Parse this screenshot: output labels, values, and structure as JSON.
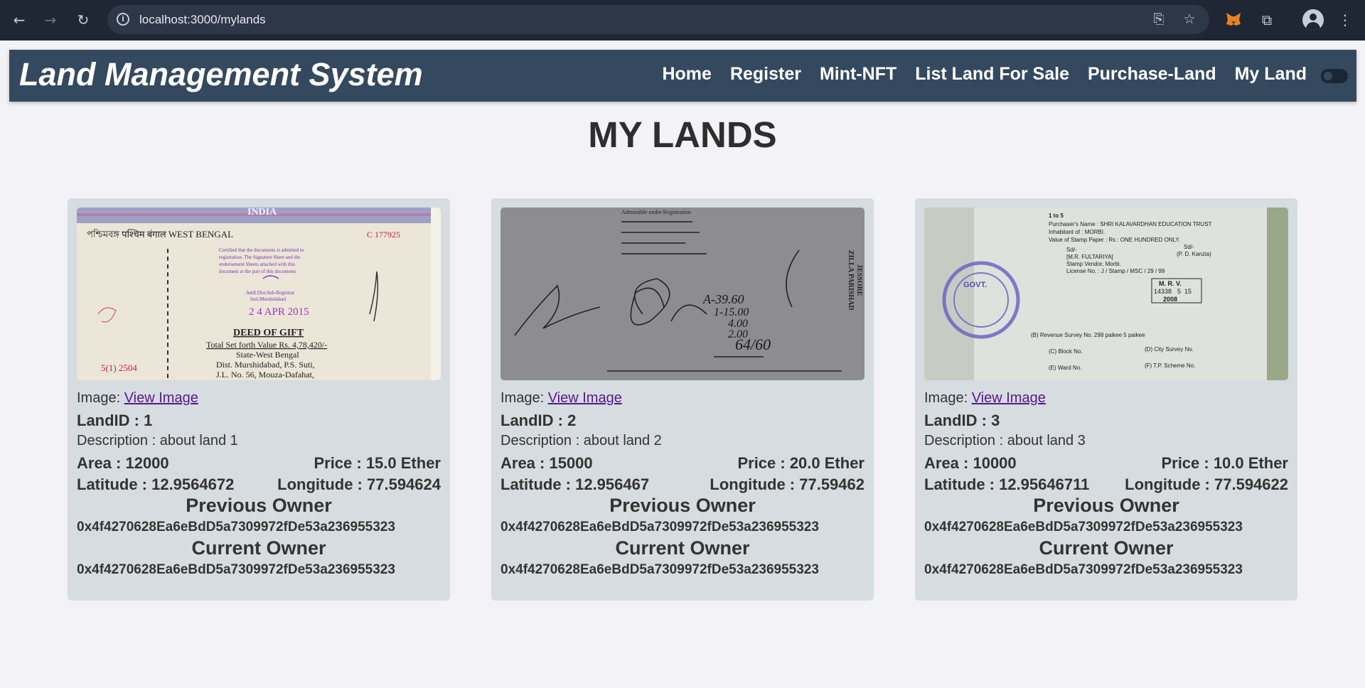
{
  "browser": {
    "url": "localhost:3000/mylands"
  },
  "app": {
    "brand": "Land Management System",
    "nav": [
      "Home",
      "Register",
      "Mint-NFT",
      "List Land For Sale",
      "Purchase-Land",
      "My Land"
    ]
  },
  "page": {
    "title": "MY LANDS"
  },
  "labels": {
    "image_prefix": "Image: ",
    "view_image": "View Image",
    "previous_owner": "Previous Owner",
    "current_owner": "Current Owner"
  },
  "cards": [
    {
      "landid": "LandID : 1",
      "description": "Description : about land 1",
      "area": "Area : 12000",
      "price": "Price : 15.0 Ether",
      "latitude": "Latitude : 12.9564672",
      "longitude": "Longitude : 77.594624",
      "previous_owner": "0x4f4270628Ea6eBdD5a7309972fDe53a236955323",
      "current_owner": "0x4f4270628Ea6eBdD5a7309972fDe53a236955323"
    },
    {
      "landid": "LandID : 2",
      "description": "Description : about land 2",
      "area": "Area : 15000",
      "price": "Price : 20.0 Ether",
      "latitude": "Latitude : 12.956467",
      "longitude": "Longitude : 77.59462",
      "previous_owner": "0x4f4270628Ea6eBdD5a7309972fDe53a236955323",
      "current_owner": "0x4f4270628Ea6eBdD5a7309972fDe53a236955323"
    },
    {
      "landid": "LandID : 3",
      "description": "Description : about land 3",
      "area": "Area : 10000",
      "price": "Price : 10.0 Ether",
      "latitude": "Latitude : 12.95646711",
      "longitude": "Longitude : 77.594622",
      "previous_owner": "0x4f4270628Ea6eBdD5a7309972fDe53a236955323",
      "current_owner": "0x4f4270628Ea6eBdD5a7309972fDe53a236955323"
    }
  ],
  "deed_images": {
    "1": {
      "title": "INDIA",
      "state_line": "পশ্চিমবঙ্গ पश्चिम बंगाल WEST BENGAL",
      "serial": "C 177925",
      "cert": [
        "Certified that the documents is admitted to",
        "registration. The Signature Sheet and the",
        "endorsement Sheets attached with this",
        "document at the part of this documents"
      ],
      "registrar": [
        "Addl.Dist.Sub-Registrar",
        "Suti,Murshidabad"
      ],
      "stamp_date": "2 4 APR 2015",
      "deed_title": "DEED OF GIFT",
      "value_line": "Total Set forth Value Rs. 4,78,420/-",
      "lines": [
        "State-West Bengal",
        "Dist. Murshidabad, P.S. Suti,",
        "J.L. No. 56, Mouza-Dafahat,"
      ],
      "margin_note": "5(1) 2504"
    },
    "2": {
      "header": [
        "Admissible under Registration",
        "ZILLA PARISHAD",
        "JESSORE"
      ],
      "amounts": [
        "A-39.60",
        "1-15.00",
        "4.00",
        "2.00",
        "64/60"
      ]
    },
    "3": {
      "lines": [
        "1 to 5",
        "Purchaser's Name : SHRI KALAVARDHAN EDUCATION TRUST",
        "Inhabitant of : MORBI.",
        "Value of Stamp Paper : Rs : ONE HUNDRED ONLY."
      ],
      "vendor": [
        "Sd/-",
        "[M.R. FULTARIYA]",
        "Stamp Vendor, Morbi.",
        "License No. : J / Stamp / MSC / 29 / 99"
      ],
      "officer": [
        "Sd/-",
        "(P. D. Kanzia)"
      ],
      "mrv": [
        "M. R. V.",
        "14338",
        "5",
        "15",
        "2008"
      ],
      "survey": "(B) Revenue Survey No. 298 paikee 5 paikee",
      "fields": [
        "(C) Block No.",
        "(D) City Survey No.",
        "(E) Ward No.",
        "(F) T.P. Scheme No."
      ],
      "seal_text": "GOVT."
    }
  }
}
